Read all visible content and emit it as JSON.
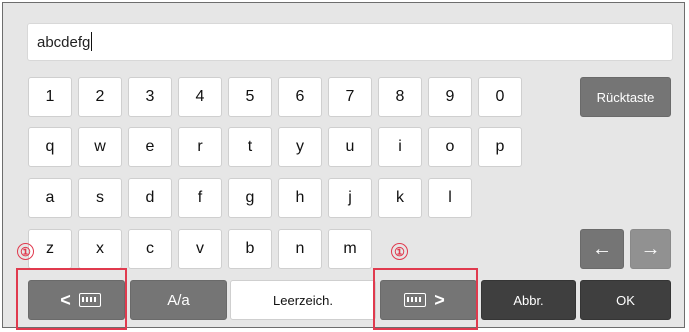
{
  "input": {
    "value": "abcdefg"
  },
  "rows": {
    "numbers": [
      "1",
      "2",
      "3",
      "4",
      "5",
      "6",
      "7",
      "8",
      "9",
      "0"
    ],
    "row_q": [
      "q",
      "w",
      "e",
      "r",
      "t",
      "y",
      "u",
      "i",
      "o",
      "p"
    ],
    "row_a": [
      "a",
      "s",
      "d",
      "f",
      "g",
      "h",
      "j",
      "k",
      "l"
    ],
    "row_z": [
      "z",
      "x",
      "c",
      "v",
      "b",
      "n",
      "m"
    ]
  },
  "keys": {
    "backspace": "Rücktaste",
    "shift": "A/a",
    "space": "Leerzeich.",
    "abbr": "Abbr.",
    "ok": "OK",
    "prev_symbol": "<",
    "next_symbol": ">",
    "left_arrow": "←",
    "right_arrow": "→"
  },
  "annotations": {
    "marker": "①"
  },
  "colors": {
    "highlight": "#e03a4e",
    "dark_key": "#757575",
    "black_key": "#3f3f3f"
  }
}
